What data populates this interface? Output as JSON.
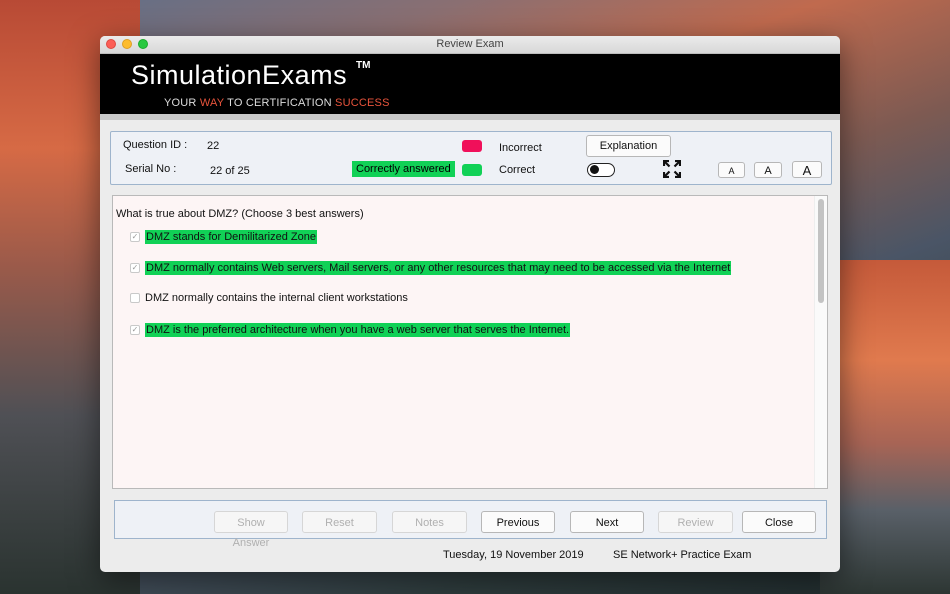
{
  "window": {
    "title": "Review Exam"
  },
  "banner": {
    "brand": "SimulationExams",
    "tm": "TM",
    "tagline_1": "YOUR ",
    "tagline_way": "WAY",
    "tagline_2": " TO CERTIFICATION ",
    "tagline_success": "SUCCESS"
  },
  "info": {
    "question_id_label": "Question ID :",
    "question_id_value": "22",
    "serial_label": "Serial No :",
    "serial_value": "22 of 25",
    "status": "Correctly answered",
    "legend_incorrect": "Incorrect",
    "legend_correct": "Correct",
    "explanation_label": "Explanation",
    "font_small": "A",
    "font_medium": "A",
    "font_large": "A"
  },
  "question": {
    "text": "What is true about DMZ? (Choose 3 best answers)",
    "options": [
      {
        "text": "DMZ stands for Demilitarized Zone",
        "checked": true,
        "correct": true
      },
      {
        "text": "DMZ normally contains Web servers, Mail servers, or any other resources that may need to be accessed via the Internet",
        "checked": true,
        "correct": true
      },
      {
        "text": "DMZ normally contains the internal client workstations",
        "checked": false,
        "correct": false
      },
      {
        "text": "DMZ is the preferred architecture when you have a web server that serves the Internet.",
        "checked": true,
        "correct": true
      }
    ]
  },
  "nav": {
    "show_answer": "Show Answer",
    "reset": "Reset",
    "notes": "Notes",
    "previous": "Previous",
    "next": "Next",
    "review": "Review",
    "close": "Close"
  },
  "footer": {
    "date": "Tuesday, 19 November 2019",
    "exam": "SE Network+ Practice Exam"
  },
  "colors": {
    "incorrect": "#f0105a",
    "correct": "#11d156"
  }
}
